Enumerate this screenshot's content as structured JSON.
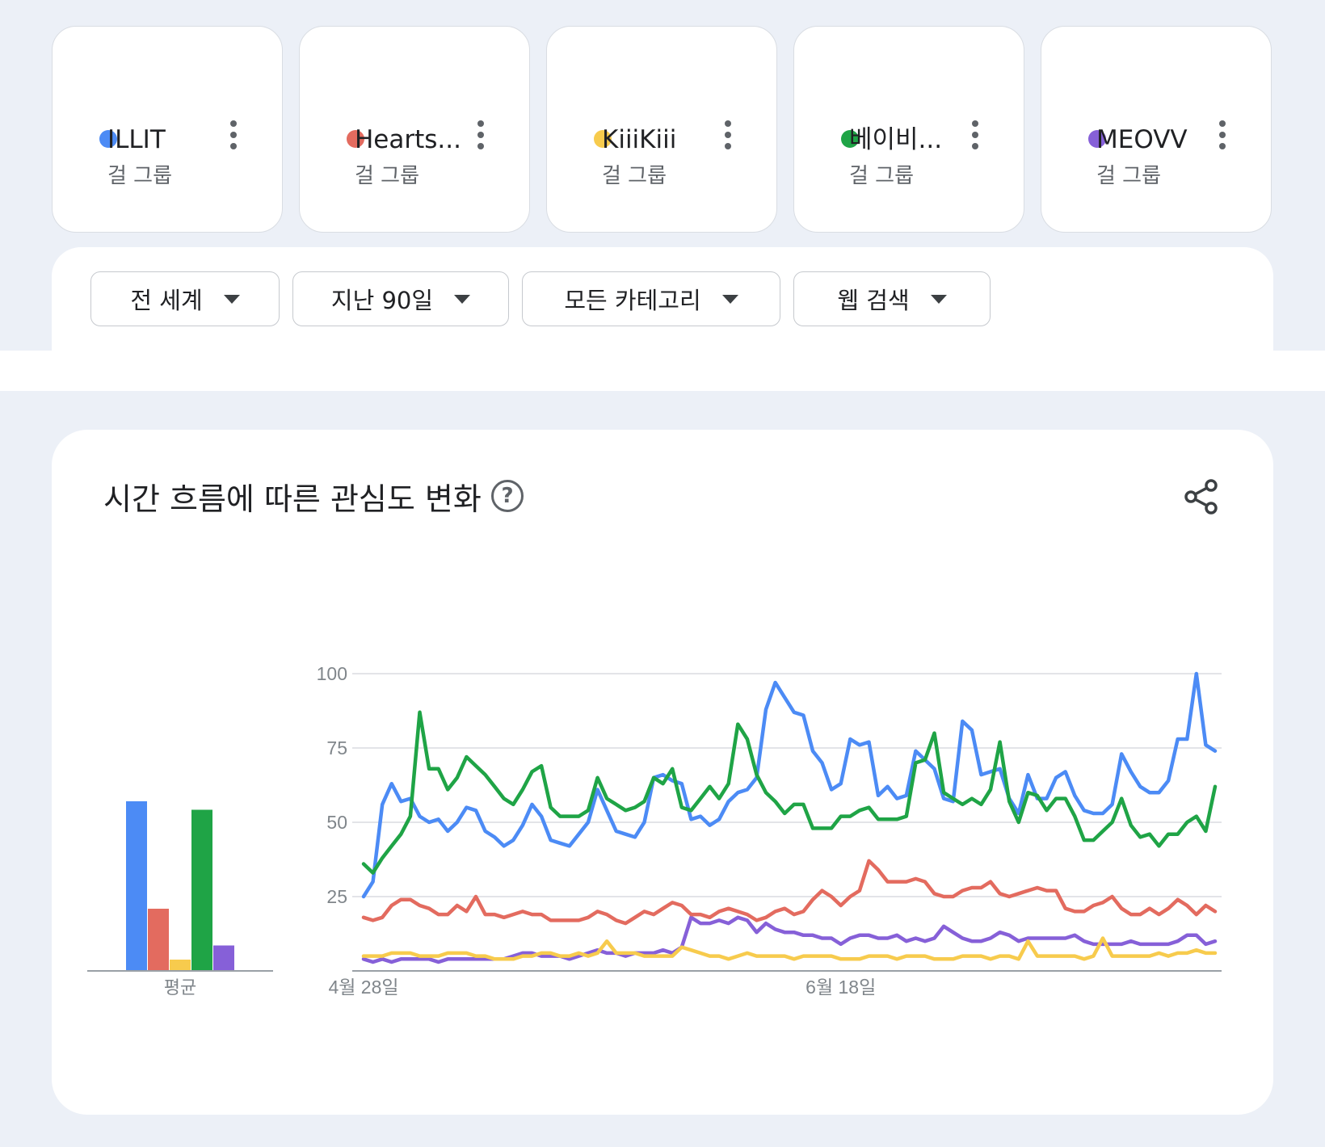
{
  "terms": [
    {
      "name": "ILLIT",
      "category": "걸 그룹",
      "color": "#4c8bf5"
    },
    {
      "name": "Hearts...",
      "category": "걸 그룹",
      "color": "#e36b5f"
    },
    {
      "name": "KiiiKiii",
      "category": "걸 그룹",
      "color": "#f7cb4d"
    },
    {
      "name": "베이비...",
      "category": "걸 그룹",
      "color": "#1fa446"
    },
    {
      "name": "MEOVV",
      "category": "걸 그룹",
      "color": "#8660d8"
    }
  ],
  "filters": {
    "region": "전 세계",
    "period": "지난 90일",
    "category": "모든 카테고리",
    "search_type": "웹 검색"
  },
  "card": {
    "title": "시간 흐름에 따른 관심도 변화",
    "help_icon": "help-circle-icon",
    "share_icon": "share-icon"
  },
  "chart_data": {
    "type": "line",
    "y_ticks": [
      "100",
      "75",
      "50",
      "25"
    ],
    "ylim": [
      0,
      100
    ],
    "x_tick_labels": [
      {
        "label": "4월 28일",
        "index": 0
      },
      {
        "label": "6월 18일",
        "index": 51
      }
    ],
    "average_label": "평균",
    "averages": [
      {
        "term": "ILLIT",
        "value": 60
      },
      {
        "term": "Hearts...",
        "value": 22
      },
      {
        "term": "KiiiKiii",
        "value": 4
      },
      {
        "term": "베이비...",
        "value": 57
      },
      {
        "term": "MEOVV",
        "value": 9
      }
    ],
    "series": [
      {
        "name": "ILLIT",
        "color": "#4c8bf5",
        "values": [
          25,
          30,
          56,
          63,
          57,
          58,
          52,
          50,
          51,
          47,
          50,
          55,
          54,
          47,
          45,
          42,
          44,
          49,
          56,
          52,
          44,
          43,
          42,
          46,
          50,
          61,
          54,
          47,
          46,
          45,
          50,
          65,
          66,
          64,
          63,
          51,
          52,
          49,
          51,
          57,
          60,
          61,
          65,
          88,
          97,
          92,
          87,
          86,
          74,
          70,
          61,
          63,
          78,
          76,
          77,
          59,
          62,
          58,
          59,
          74,
          71,
          68,
          58,
          57,
          84,
          81,
          66,
          67,
          68,
          58,
          53,
          66,
          58,
          58,
          65,
          67,
          59,
          54,
          53,
          53,
          56,
          73,
          67,
          62,
          60,
          60,
          64,
          78,
          78,
          100,
          76,
          74
        ]
      },
      {
        "name": "Hearts...",
        "color": "#e36b5f",
        "values": [
          18,
          17,
          18,
          22,
          24,
          24,
          22,
          21,
          19,
          19,
          22,
          20,
          25,
          19,
          19,
          18,
          19,
          20,
          19,
          19,
          17,
          17,
          17,
          17,
          18,
          20,
          19,
          17,
          16,
          18,
          20,
          19,
          21,
          23,
          22,
          19,
          19,
          18,
          20,
          21,
          20,
          19,
          17,
          18,
          20,
          21,
          19,
          20,
          24,
          27,
          25,
          22,
          25,
          27,
          37,
          34,
          30,
          30,
          30,
          31,
          30,
          26,
          25,
          25,
          27,
          28,
          28,
          30,
          26,
          25,
          26,
          27,
          28,
          27,
          27,
          21,
          20,
          20,
          22,
          23,
          25,
          21,
          19,
          19,
          21,
          19,
          21,
          24,
          22,
          19,
          22,
          20
        ]
      },
      {
        "name": "KiiiKiii",
        "color": "#f7cb4d",
        "values": [
          5,
          5,
          5,
          6,
          6,
          6,
          5,
          5,
          5,
          6,
          6,
          6,
          5,
          5,
          4,
          4,
          4,
          5,
          5,
          6,
          6,
          5,
          5,
          6,
          5,
          6,
          10,
          6,
          6,
          6,
          5,
          5,
          5,
          5,
          8,
          7,
          6,
          5,
          5,
          4,
          5,
          6,
          5,
          5,
          5,
          5,
          4,
          5,
          5,
          5,
          5,
          4,
          4,
          4,
          5,
          5,
          5,
          4,
          5,
          5,
          5,
          4,
          4,
          4,
          5,
          5,
          5,
          4,
          5,
          5,
          4,
          10,
          5,
          5,
          5,
          5,
          5,
          4,
          5,
          11,
          5,
          5,
          5,
          5,
          5,
          6,
          5,
          6,
          6,
          7,
          6,
          6
        ]
      },
      {
        "name": "베이비...",
        "color": "#1fa446",
        "values": [
          36,
          33,
          38,
          42,
          46,
          52,
          87,
          68,
          68,
          61,
          65,
          72,
          69,
          66,
          62,
          58,
          56,
          61,
          67,
          69,
          55,
          52,
          52,
          52,
          54,
          65,
          58,
          56,
          54,
          55,
          57,
          65,
          63,
          68,
          55,
          54,
          58,
          62,
          58,
          63,
          83,
          78,
          66,
          60,
          57,
          53,
          56,
          56,
          48,
          48,
          48,
          52,
          52,
          54,
          55,
          51,
          51,
          51,
          52,
          70,
          71,
          80,
          60,
          58,
          56,
          58,
          56,
          61,
          77,
          57,
          50,
          60,
          59,
          54,
          58,
          58,
          52,
          44,
          44,
          47,
          50,
          58,
          49,
          45,
          46,
          42,
          46,
          46,
          50,
          52,
          47,
          62
        ]
      },
      {
        "name": "MEOVV",
        "color": "#8660d8",
        "values": [
          4,
          3,
          4,
          3,
          4,
          4,
          4,
          4,
          3,
          4,
          4,
          4,
          4,
          4,
          4,
          4,
          5,
          6,
          6,
          5,
          5,
          5,
          4,
          5,
          6,
          7,
          6,
          6,
          5,
          6,
          6,
          6,
          7,
          6,
          8,
          18,
          16,
          16,
          17,
          16,
          18,
          17,
          13,
          16,
          14,
          13,
          13,
          12,
          12,
          11,
          11,
          9,
          11,
          12,
          12,
          11,
          11,
          12,
          10,
          11,
          10,
          11,
          15,
          13,
          11,
          10,
          10,
          11,
          13,
          12,
          10,
          11,
          11,
          11,
          11,
          11,
          12,
          10,
          9,
          9,
          9,
          9,
          10,
          9,
          9,
          9,
          9,
          10,
          12,
          12,
          9,
          10
        ]
      }
    ]
  }
}
